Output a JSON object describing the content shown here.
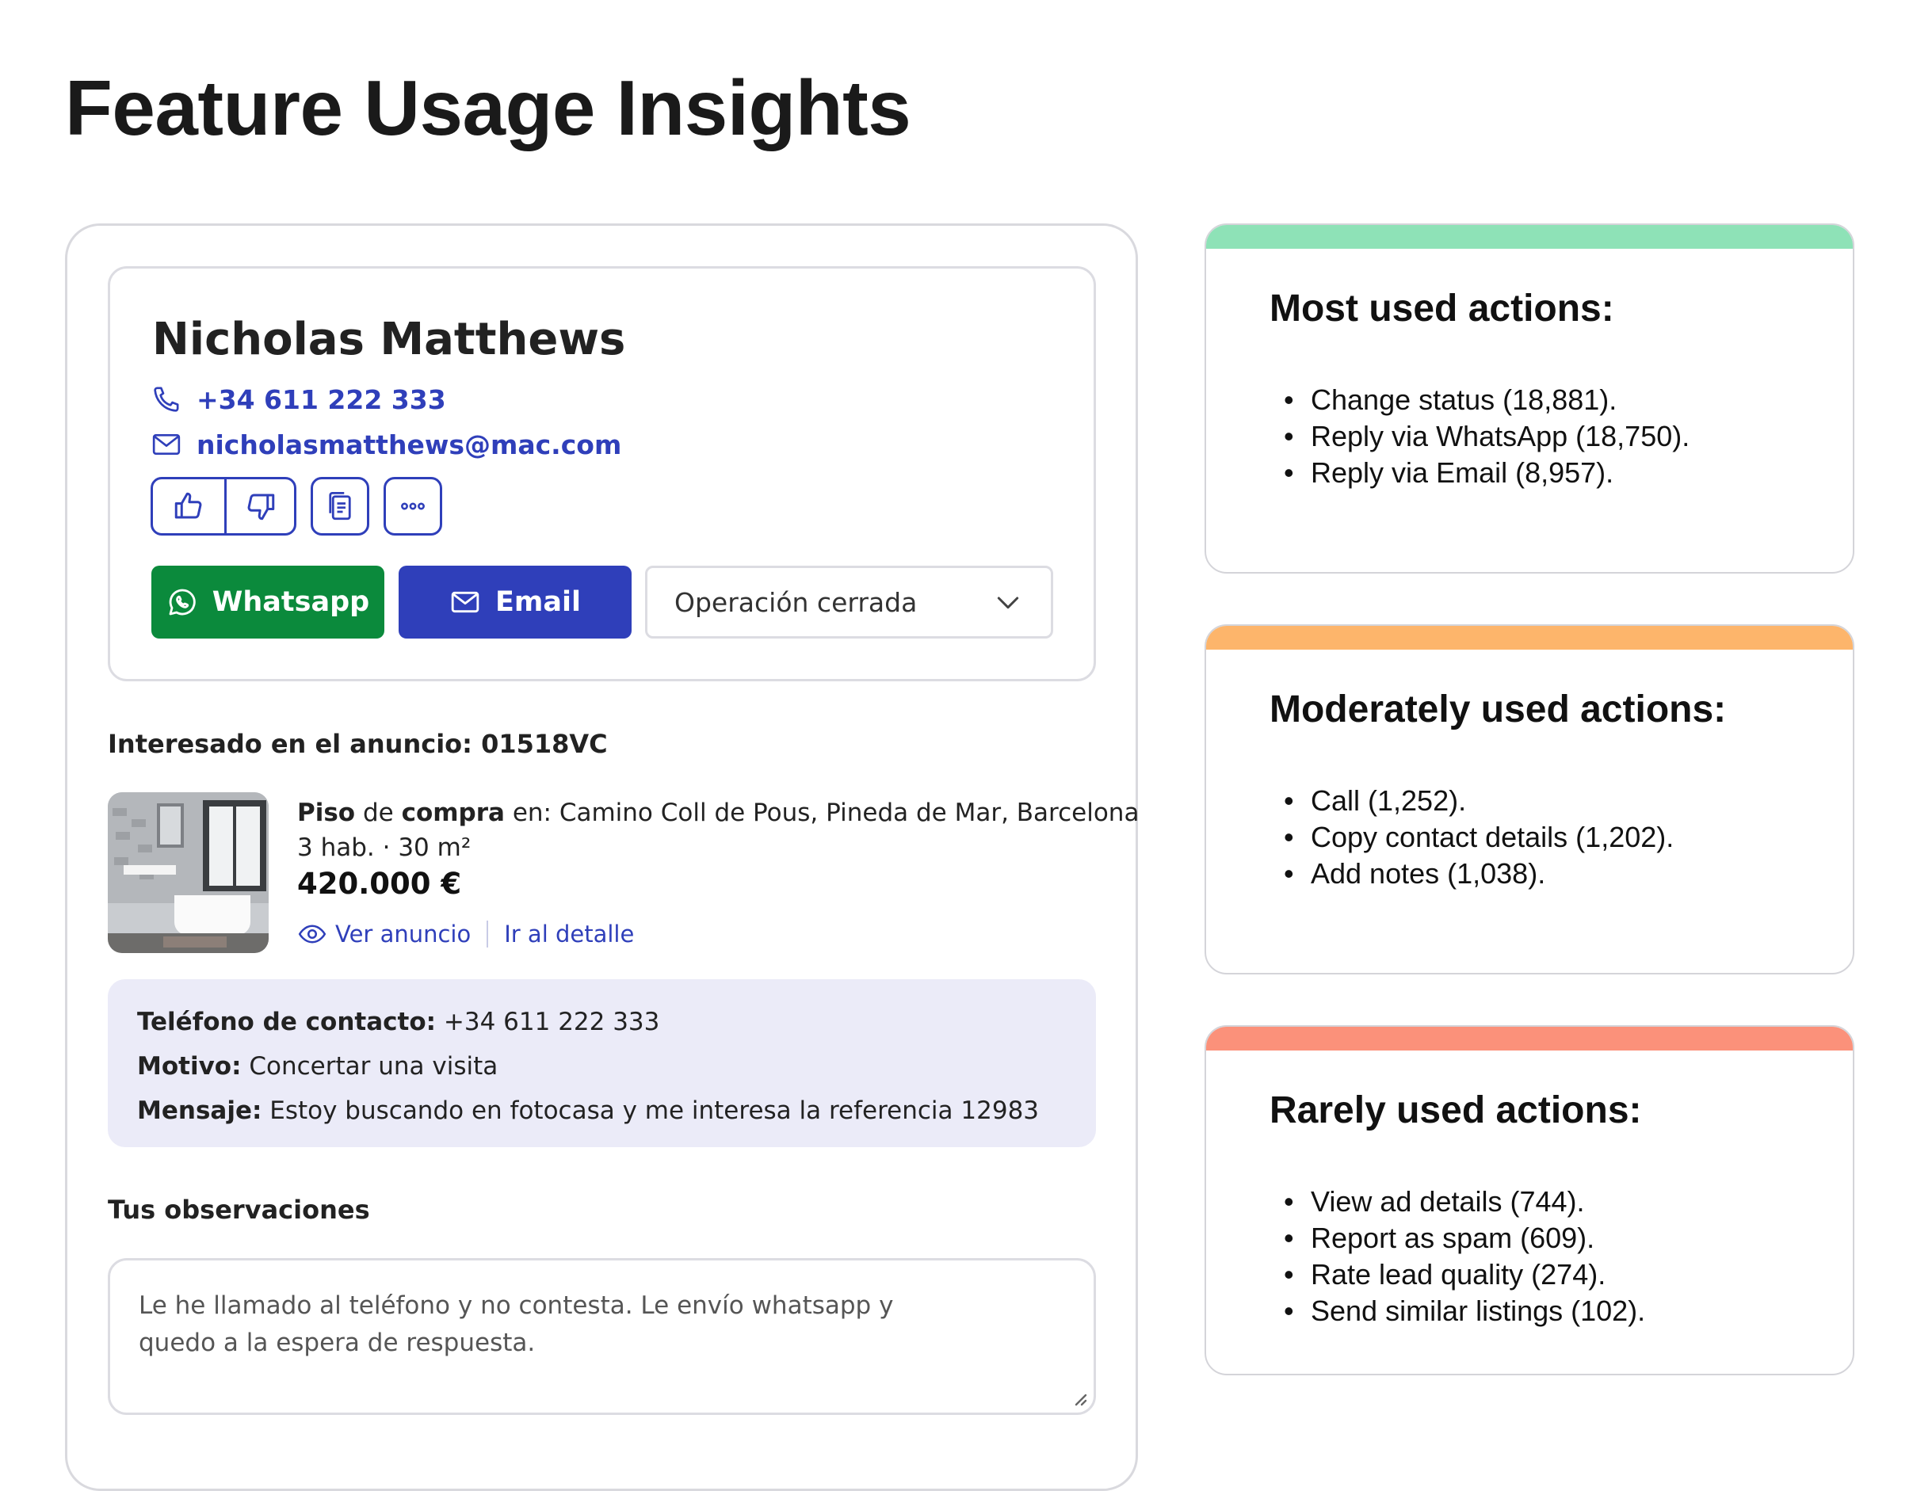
{
  "page": {
    "title": "Feature Usage Insights"
  },
  "contact": {
    "name": "Nicholas Matthews",
    "phone": "+34 611 222 333",
    "email": "nicholasmatthews@mac.com",
    "whatsapp_label": "Whatsapp",
    "email_label": "Email",
    "status": "Operación cerrada"
  },
  "listing": {
    "interest_label": "Interesado en el anuncio: 01518VC",
    "type": "Piso",
    "de": "de",
    "operation": "compra",
    "location": "en: Camino Coll de Pous, Pineda de Mar, Barcelona",
    "details": "3 hab. · 30 m²",
    "price": "420.000 €",
    "view_link": "Ver anuncio",
    "detail_link": "Ir al detalle"
  },
  "info": {
    "phone_label": "Teléfono de contacto:",
    "phone_value": "+34 611 222 333",
    "reason_label": "Motivo:",
    "reason_value": "Concertar una visita",
    "message_label": "Mensaje:",
    "message_value": "Estoy buscando en fotocasa y me interesa la referencia 12983"
  },
  "notes": {
    "label": "Tus observaciones",
    "text_line1": "Le he llamado al teléfono y no contesta. Le envío whatsapp y",
    "text_line2": "quedo a la espera de respuesta."
  },
  "insights": [
    {
      "heading": "Most used actions:",
      "color": "#8ee2b7",
      "items": [
        "Change status (18,881).",
        "Reply via WhatsApp (18,750).",
        "Reply via Email (8,957)."
      ]
    },
    {
      "heading": "Moderately used actions:",
      "color": "#fdb56b",
      "items": [
        "Call (1,252).",
        "Copy contact details (1,202).",
        "Add notes (1,038)."
      ]
    },
    {
      "heading": "Rarely used actions:",
      "color": "#fb917a",
      "items": [
        "View ad details (744).",
        "Report as spam (609).",
        "Rate lead quality (274).",
        "Send similar listings (102)."
      ]
    }
  ],
  "colors": {
    "accent": "#2f3fba",
    "whatsapp": "#0b8a3c",
    "info_bg": "#ebebf8"
  }
}
